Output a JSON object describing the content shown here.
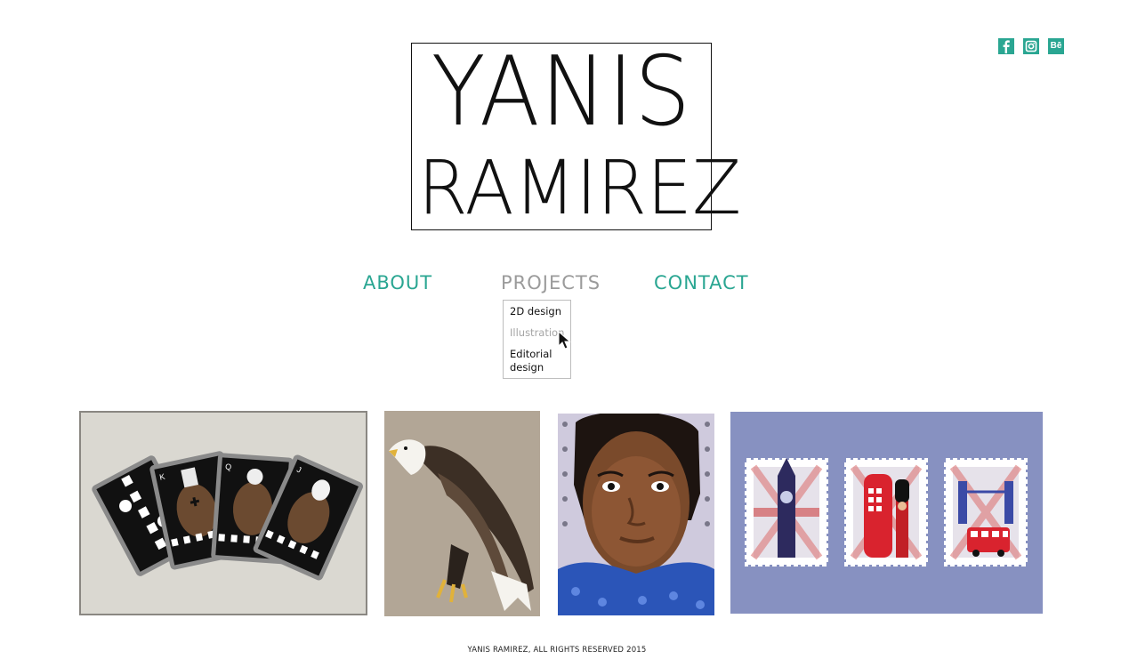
{
  "social": {
    "icons": [
      {
        "name": "facebook-icon",
        "glyph": "f"
      },
      {
        "name": "instagram-icon",
        "glyph": ""
      },
      {
        "name": "behance-icon",
        "glyph": "Bē"
      }
    ],
    "color": "#2aa692"
  },
  "logo": {
    "line1": "YANIS",
    "line2": "RAMIREZ"
  },
  "nav": {
    "about": "ABOUT",
    "projects": "PROJECTS",
    "contact": "CONTACT",
    "accent": "#2aa692",
    "active_color": "#9b9b9b"
  },
  "projects_menu": {
    "items": [
      "2D design",
      "Illustration",
      "Editorial design"
    ],
    "hovered": "Illustration"
  },
  "gallery": {
    "tiles": [
      {
        "name": "playing-cards-artwork",
        "cards": [
          "K",
          "Q",
          "J"
        ]
      },
      {
        "name": "eagle-illustration"
      },
      {
        "name": "self-portrait-illustration"
      },
      {
        "name": "london-stamps-illustration"
      }
    ]
  },
  "footer": {
    "text": "YANIS RAMIREZ,  ALL RIGHTS RESERVED 2015"
  }
}
